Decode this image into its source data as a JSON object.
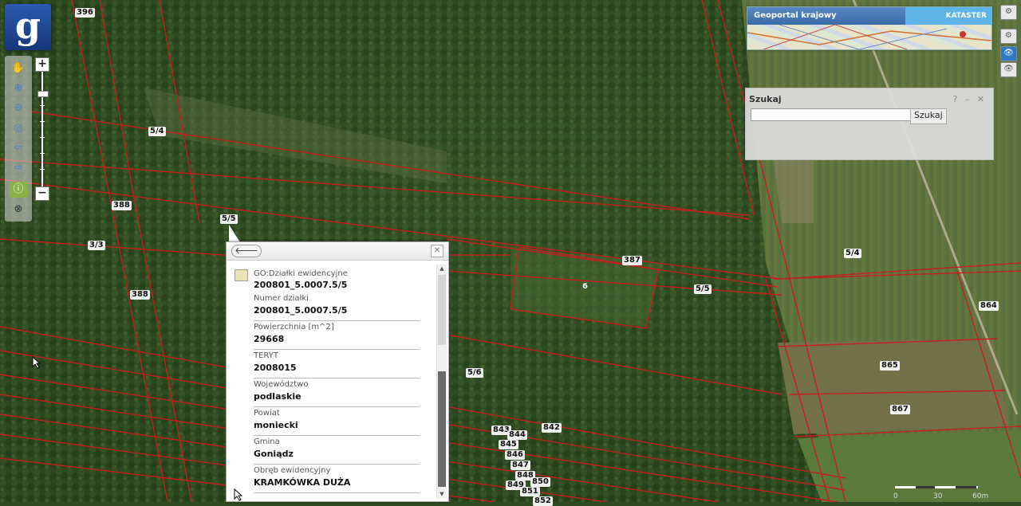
{
  "app": {
    "logo_letter": "g"
  },
  "banner": {
    "title": "Geoportal krajowy",
    "layer": "KATASTER"
  },
  "toolbar": {
    "tools": [
      {
        "name": "pan-icon",
        "glyph": "✋"
      },
      {
        "name": "zoom-in-icon",
        "glyph": "⊕"
      },
      {
        "name": "zoom-out-icon",
        "glyph": "⊖"
      },
      {
        "name": "zoom-extent-icon",
        "glyph": "◎"
      },
      {
        "name": "back-arrow-icon",
        "glyph": "⇦"
      },
      {
        "name": "forward-arrow-icon",
        "glyph": "⇨"
      },
      {
        "name": "info-icon",
        "glyph": "ⓘ"
      },
      {
        "name": "measure-icon",
        "glyph": "⊗"
      }
    ],
    "zoom_in": "+",
    "zoom_out": "−"
  },
  "search": {
    "title": "Szukaj",
    "help": "?",
    "minimize": "–",
    "close": "✕",
    "input_value": "",
    "button": "Szukaj"
  },
  "popup": {
    "back": "🡐",
    "close": "✕",
    "layer_name": "GO:Działki ewidencyjne",
    "layer_id": "200801_5.0007.5/5",
    "fields": [
      {
        "label": "Numer działki",
        "value": "200801_5.0007.5/5"
      },
      {
        "label": "Powierzchnia [m^2]",
        "value": "29668"
      },
      {
        "label": "TERYT",
        "value": "2008015"
      },
      {
        "label": "Województwo",
        "value": "podlaskie"
      },
      {
        "label": "Powiat",
        "value": "moniecki"
      },
      {
        "label": "Gmina",
        "value": "Goniądz"
      },
      {
        "label": "Obręb ewidencyjny",
        "value": "KRAMKÓWKA DUŻA"
      }
    ]
  },
  "parcel_labels": [
    "396",
    "5/4",
    "388",
    "5/5",
    "3/3",
    "388",
    "387",
    "6",
    "5/5",
    "5/4",
    "864",
    "865",
    "867",
    "5/6",
    "843",
    "844",
    "842",
    "845",
    "846",
    "847",
    "848",
    "849",
    "850",
    "851",
    "852"
  ],
  "scale": {
    "labels": [
      "0",
      "30",
      "60m"
    ]
  },
  "colors": {
    "parcel_line": "#c41e1e",
    "banner_blue": "#3a6aa8",
    "kataster_blue": "#5eb4e6"
  }
}
